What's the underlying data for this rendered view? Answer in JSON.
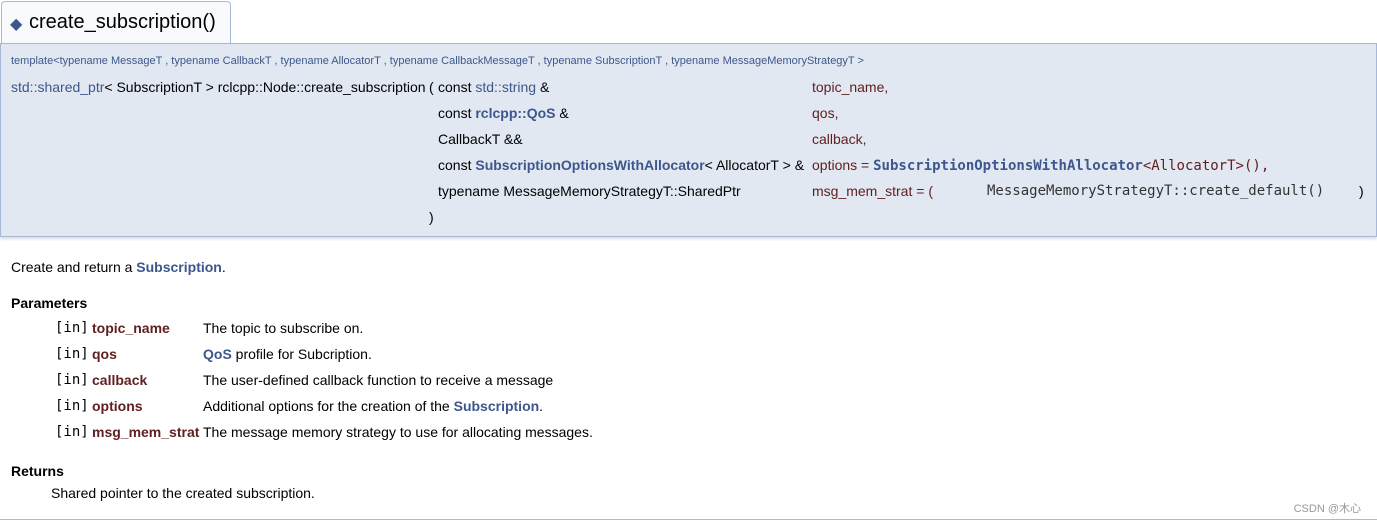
{
  "header": {
    "title": "create_subscription()",
    "icon": "diamond-icon"
  },
  "prototype": {
    "template_line": "template<typename MessageT , typename CallbackT , typename AllocatorT , typename CallbackMessageT , typename SubscriptionT , typename MessageMemoryStrategyT >",
    "return_link": "std::shared_ptr",
    "return_rest": "< SubscriptionT > rclcpp::Node::create_subscription",
    "open_paren": "(",
    "close_paren": ")",
    "params": [
      {
        "pre": "const ",
        "link": "std::string",
        "post": " &",
        "name": "topic_name,"
      },
      {
        "pre": "const ",
        "link": "rclcpp::QoS",
        "post": " &",
        "name": "qos,"
      },
      {
        "pre": "CallbackT &&",
        "link": "",
        "post": "",
        "name": "callback,"
      },
      {
        "pre": "const ",
        "link": "SubscriptionOptionsWithAllocator",
        "post": "< AllocatorT > &",
        "name": "options = ",
        "default_link": "SubscriptionOptionsWithAllocator",
        "default_rest": "<AllocatorT>(),"
      },
      {
        "pre": "typename MessageMemoryStrategyT::SharedPtr",
        "link": "",
        "post": "",
        "name": "msg_mem_strat = (",
        "default_code": "MessageMemoryStrategyT::create_default()",
        "default_close": ")"
      }
    ]
  },
  "description": {
    "pre": "Create and return a ",
    "link": "Subscription",
    "post": "."
  },
  "parameters": {
    "title": "Parameters",
    "items": [
      {
        "dir": "[in]",
        "name": "topic_name",
        "desc": "The topic to subscribe on.",
        "desc_link": "",
        "desc_post": ""
      },
      {
        "dir": "[in]",
        "name": "qos",
        "desc": "",
        "desc_link": "QoS",
        "desc_post": " profile for Subcription."
      },
      {
        "dir": "[in]",
        "name": "callback",
        "desc": "The user-defined callback function to receive a message",
        "desc_link": "",
        "desc_post": ""
      },
      {
        "dir": "[in]",
        "name": "options",
        "desc": "Additional options for the creation of the ",
        "desc_link": "Subscription",
        "desc_post": "."
      },
      {
        "dir": "[in]",
        "name": "msg_mem_strat",
        "desc": "The message memory strategy to use for allocating messages.",
        "desc_link": "",
        "desc_post": ""
      }
    ]
  },
  "returns": {
    "title": "Returns",
    "text": "Shared pointer to the created subscription."
  },
  "watermark": "CSDN @木心",
  "colors": {
    "link": "#3d578c",
    "param_name": "#602020",
    "header_bg": "#e2e8f2",
    "border": "#a8b8d9"
  }
}
